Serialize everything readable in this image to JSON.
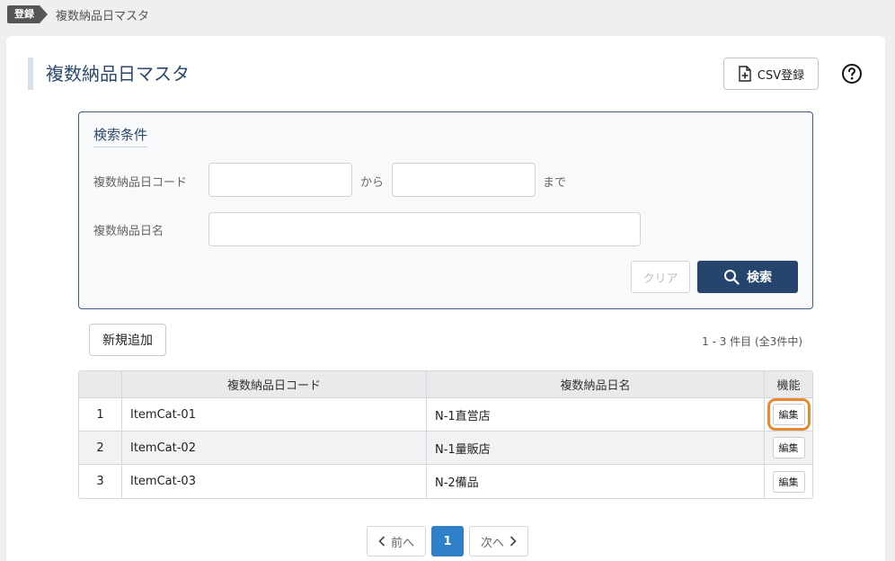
{
  "breadcrumb": {
    "badge": "登録",
    "current": "複数納品日マスタ"
  },
  "page": {
    "title": "複数納品日マスタ"
  },
  "toolbar": {
    "csv_label": "CSV登録",
    "help_icon": "question-circle-icon"
  },
  "search": {
    "heading": "検索条件",
    "code_label": "複数納品日コード",
    "range_from": "から",
    "range_to": "まで",
    "code_from_value": "",
    "code_to_value": "",
    "name_label": "複数納品日名",
    "name_value": "",
    "clear_label": "クリア",
    "search_label": "検索"
  },
  "list": {
    "add_label": "新規追加",
    "count_text": "1 - 3 件目 (全3件中)",
    "columns": [
      "",
      "複数納品日コード",
      "複数納品日名",
      "機能"
    ],
    "rows": [
      {
        "no": "1",
        "code": "ItemCat-01",
        "name": "N-1直営店",
        "action": "編集"
      },
      {
        "no": "2",
        "code": "ItemCat-02",
        "name": "N-1量販店",
        "action": "編集"
      },
      {
        "no": "3",
        "code": "ItemCat-03",
        "name": "N-2備品",
        "action": "編集"
      }
    ]
  },
  "pagination": {
    "prev": "前へ",
    "current": "1",
    "next": "次へ"
  },
  "colors": {
    "accent": "#26456e",
    "page_active": "#2f80c9",
    "focus": "#e8892f"
  }
}
